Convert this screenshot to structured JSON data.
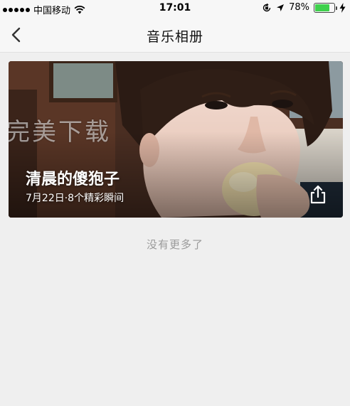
{
  "status_bar": {
    "carrier": "中国移动",
    "time": "17:01",
    "battery_percent": "78%",
    "battery_level": 0.78,
    "icons": [
      "signal-dots-icon",
      "wifi-icon",
      "orientation-lock-icon",
      "location-arrow-icon",
      "battery-icon",
      "charging-bolt-icon"
    ]
  },
  "nav": {
    "title": "音乐相册",
    "back_icon": "chevron-left-icon"
  },
  "album": {
    "watermark": "完美下载",
    "title": "清晨的傻狍子",
    "meta": "7月22日·8个精彩瞬间",
    "share_icon": "share-icon"
  },
  "footer": {
    "no_more_text": "没有更多了"
  },
  "colors": {
    "background": "#efefef",
    "bar_background": "#f7f7f7",
    "battery_green": "#3fd14d",
    "muted_text": "#9a9a9a"
  }
}
